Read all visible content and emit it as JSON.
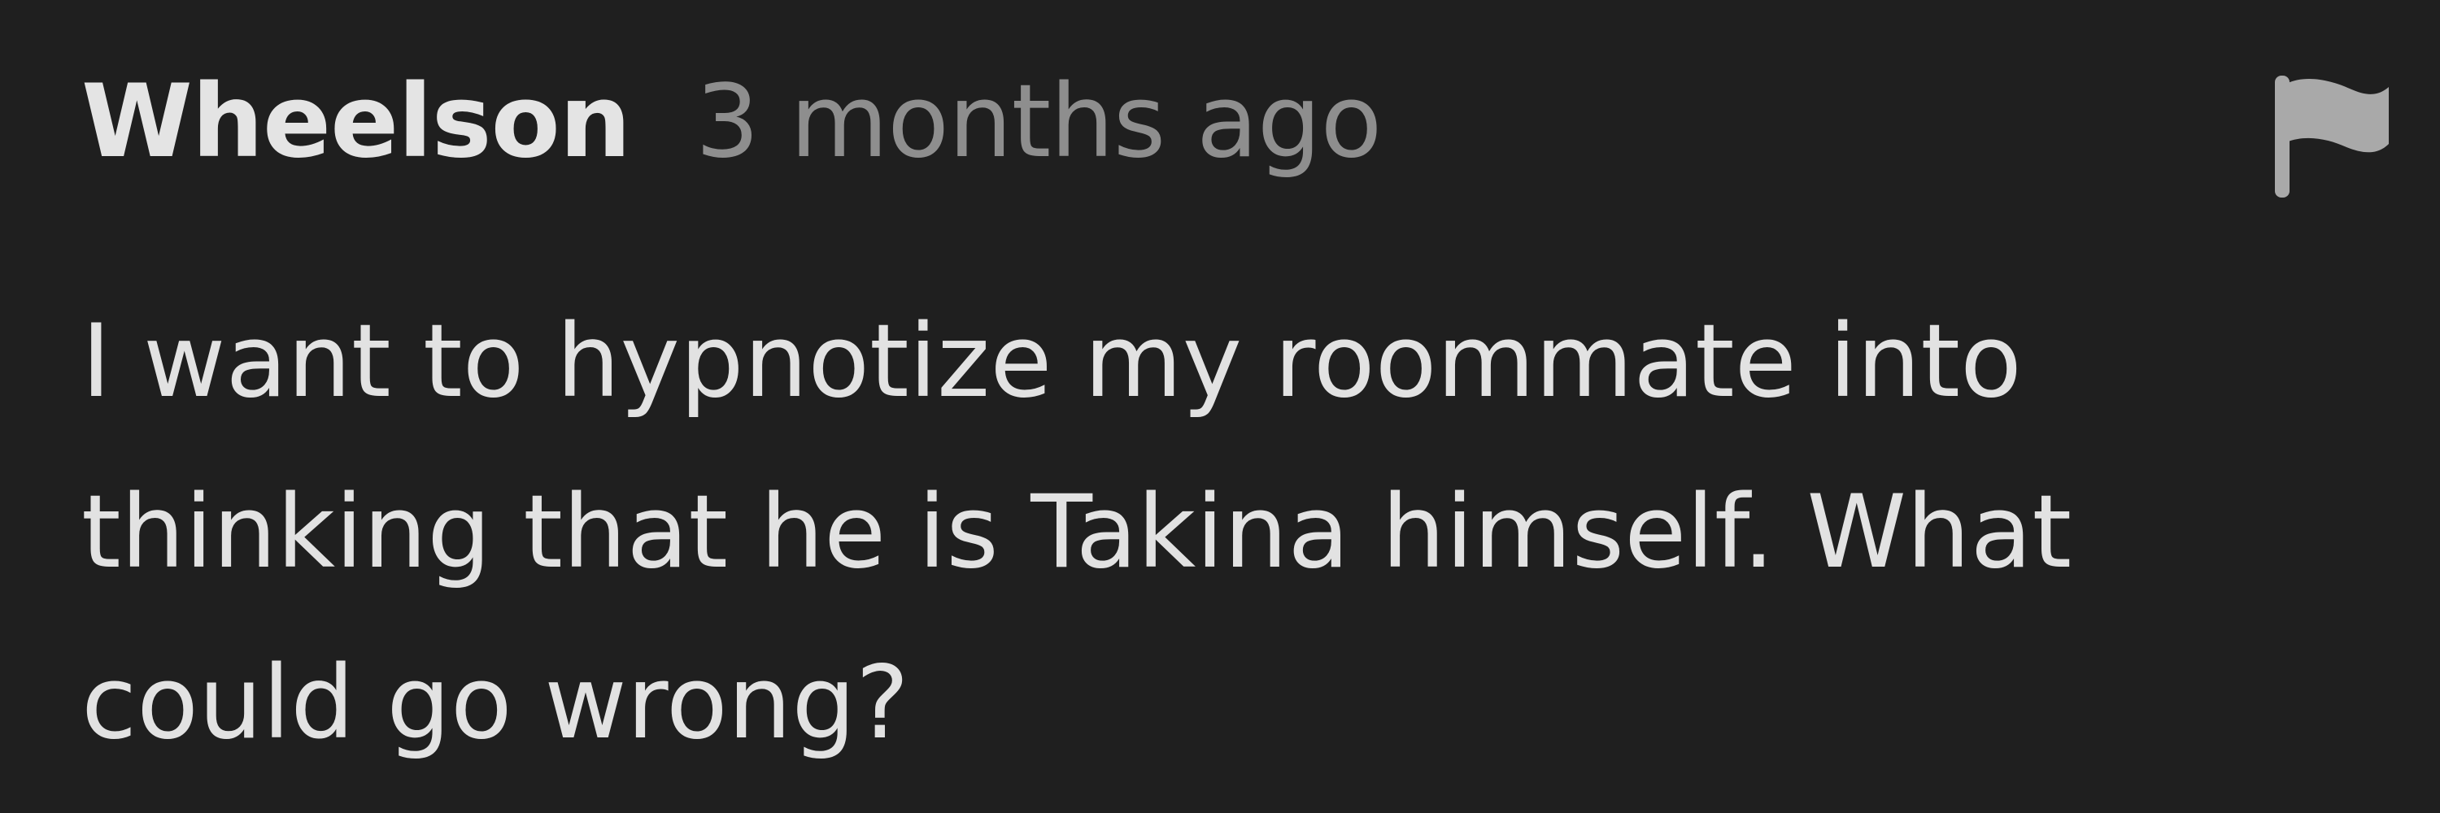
{
  "comment": {
    "author": "Wheelson",
    "timestamp": "3 months ago",
    "body_lines": [
      "I want to hypnotize my roommate into",
      "thinking that he is Takina himself. What",
      "could go wrong?"
    ],
    "flag_icon": "flag-icon"
  },
  "colors": {
    "background": "#1f1f1f",
    "author": "#e4e4e4",
    "timestamp": "#8e8e8e",
    "body": "#e2e2e2",
    "icon": "#a9a9a9"
  }
}
